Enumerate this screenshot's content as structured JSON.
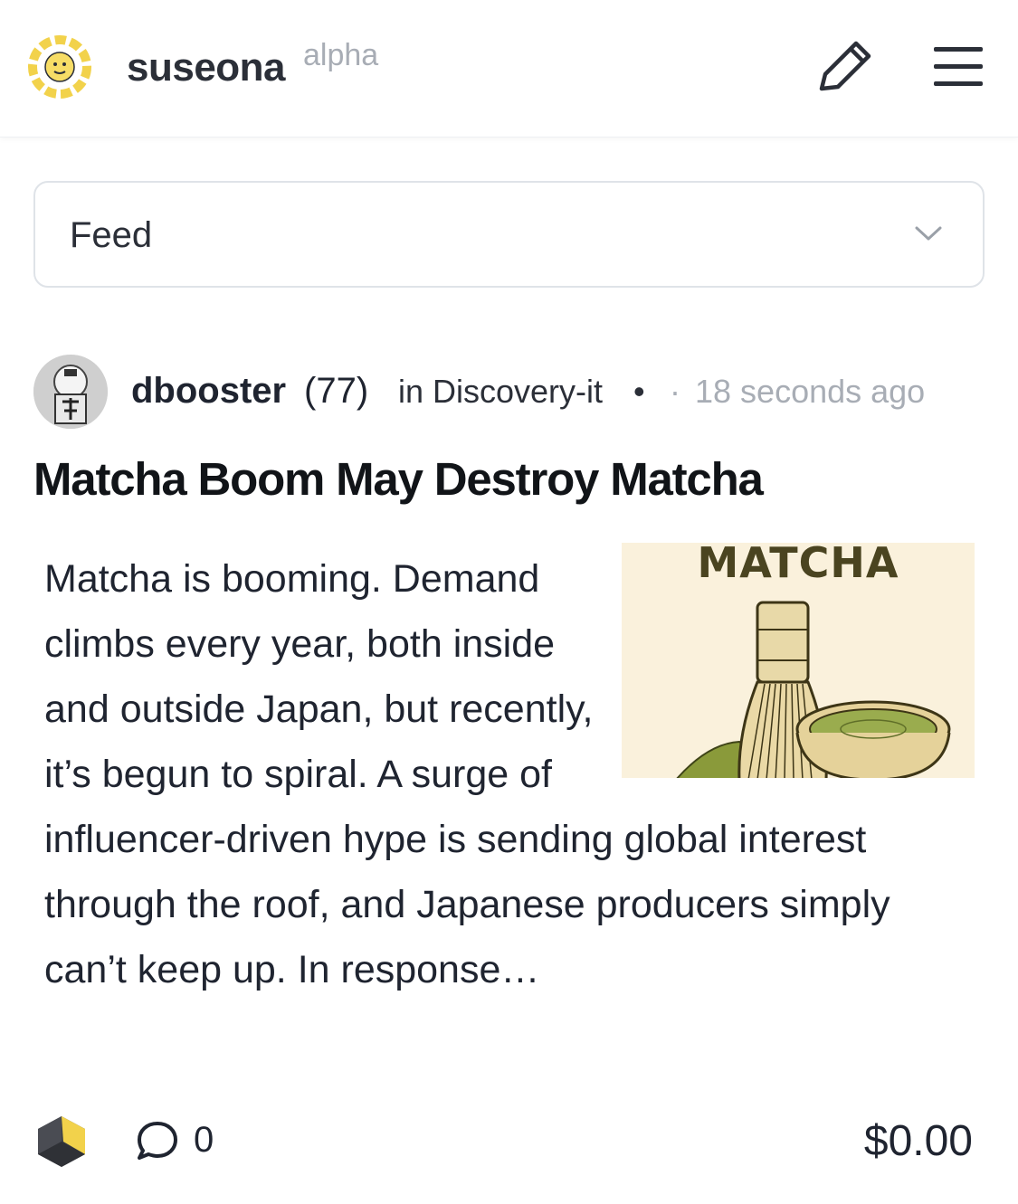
{
  "header": {
    "brand": "suseona",
    "brand_tag": "alpha",
    "logo_text": "SUSEONA",
    "logo_icon": "suseona-logo-icon",
    "edit_icon": "pencil-icon",
    "menu_icon": "hamburger-menu-icon"
  },
  "feed_selector": {
    "selected": "Feed",
    "icon": "chevron-down-icon"
  },
  "post": {
    "author": "dbooster",
    "author_reputation": "(77)",
    "community": "in Discovery-it",
    "dot": "•",
    "dot2": "·",
    "timestamp": "18 seconds ago",
    "title": "Matcha Boom May Destroy Matcha",
    "excerpt": "Matcha is booming. Demand climbs every year, both inside and outside Japan, but recently, it’s begun to spiral. A surge of influencer-driven hype is sending global interest through the roof, and Japanese producers simply can’t keep up. In response…",
    "thumbnail_label": "MATCHA",
    "comment_count": "0",
    "payout": "$0.00"
  },
  "colors": {
    "brand_yellow": "#f2d24b",
    "text_dark": "#1f2430",
    "muted": "#a8adb5",
    "border": "#dfe3e8"
  }
}
